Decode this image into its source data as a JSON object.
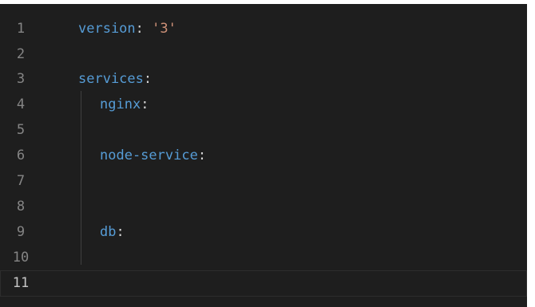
{
  "editor": {
    "language": "yaml",
    "colors": {
      "background": "#1e1e1e",
      "line_number": "#858585",
      "line_number_active": "#c6c6c6",
      "key": "#569cd6",
      "string": "#ce9178",
      "punctuation": "#d4d4d4"
    },
    "lines": [
      {
        "number": "1",
        "key": "version",
        "colon": ":",
        "value": " '3'"
      },
      {
        "number": "2"
      },
      {
        "number": "3",
        "key": "services",
        "colon": ":"
      },
      {
        "number": "4",
        "key": "nginx",
        "colon": ":"
      },
      {
        "number": "5"
      },
      {
        "number": "6",
        "key": "node-service",
        "colon": ":"
      },
      {
        "number": "7"
      },
      {
        "number": "8"
      },
      {
        "number": "9",
        "key": "db",
        "colon": ":"
      },
      {
        "number": "10"
      },
      {
        "number": "11"
      }
    ]
  }
}
